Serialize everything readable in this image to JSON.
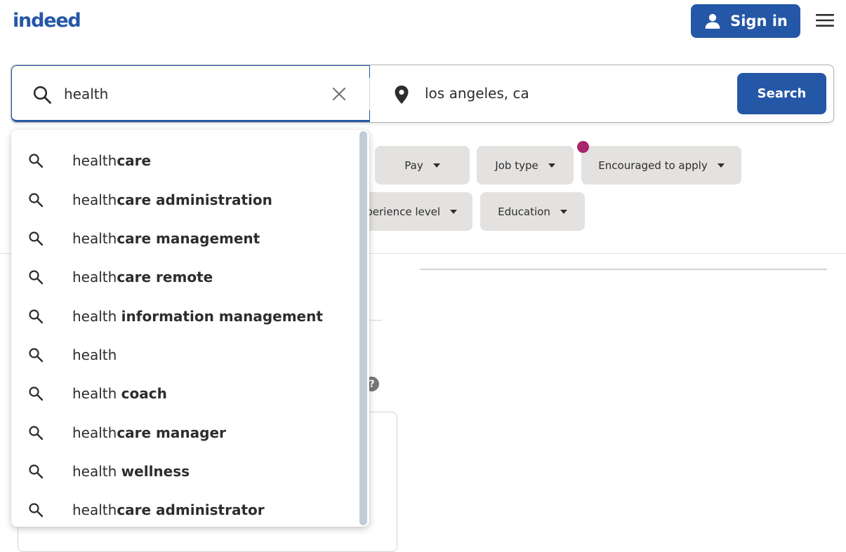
{
  "header": {
    "logo_text": "indeed",
    "signin_label": "Sign in",
    "colors": {
      "brand": "#2557a7",
      "notification": "#a9266c"
    }
  },
  "search": {
    "what_value": "health",
    "where_value": "los angeles, ca",
    "search_label": "Search"
  },
  "filters": {
    "pay": "Pay",
    "job_type": "Job type",
    "encouraged": "Encouraged to apply",
    "experience": "perience level",
    "education": "Education"
  },
  "background": {
    "help_glyph": "?"
  },
  "suggestions": [
    {
      "prefix": "health",
      "bold": "care"
    },
    {
      "prefix": "health",
      "bold": "care administration"
    },
    {
      "prefix": "health",
      "bold": "care management"
    },
    {
      "prefix": "health",
      "bold": "care remote"
    },
    {
      "prefix": "health ",
      "bold": "information management"
    },
    {
      "prefix": "health",
      "bold": ""
    },
    {
      "prefix": "health ",
      "bold": "coach"
    },
    {
      "prefix": "health",
      "bold": "care manager"
    },
    {
      "prefix": "health ",
      "bold": "wellness"
    },
    {
      "prefix": "health",
      "bold": "care administrator"
    }
  ]
}
